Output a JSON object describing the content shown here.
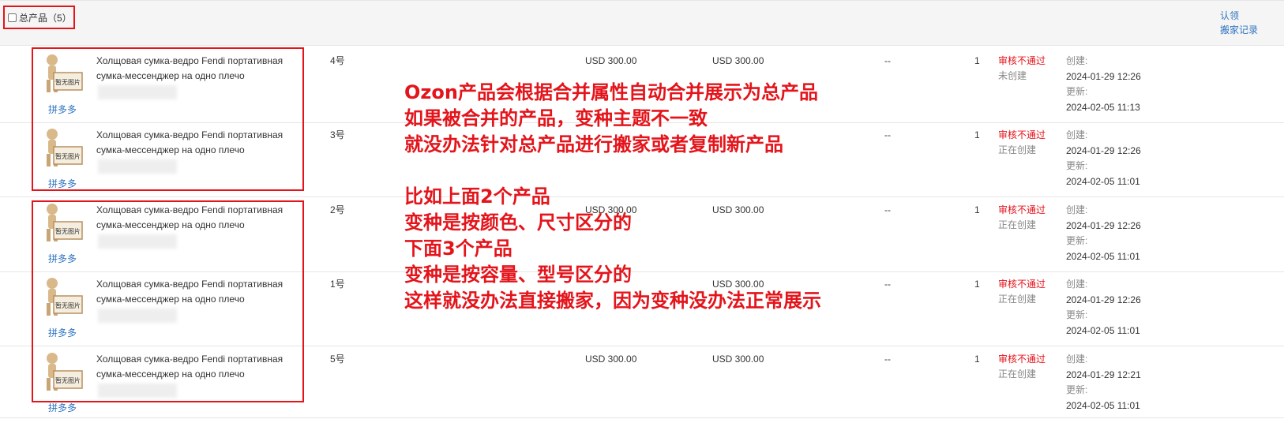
{
  "header": {
    "select_all_label": "总产品（5）",
    "links": [
      "认领",
      "搬家记录"
    ]
  },
  "placeholder_image_label": "暂无图片",
  "rows": [
    {
      "source": "拼多多",
      "title": "Холщовая сумка-ведро Fendi портативная сумка-мессенджер на одно плечо",
      "variant": "4号",
      "price1": "USD 300.00",
      "price2": "USD 300.00",
      "dash": "--",
      "qty": "1",
      "status1": "审核不通过",
      "status2": "未创建",
      "created_label": "创建:",
      "created": "2024-01-29 12:26",
      "updated_label": "更新:",
      "updated": "2024-02-05 11:13"
    },
    {
      "source": "拼多多",
      "title": "Холщовая сумка-ведро Fendi портативная сумка-мессенджер на одно плечо",
      "variant": "3号",
      "price1": "",
      "price2": "",
      "dash": "--",
      "qty": "1",
      "status1": "审核不通过",
      "status2": "正在创建",
      "created_label": "创建:",
      "created": "2024-01-29 12:26",
      "updated_label": "更新:",
      "updated": "2024-02-05 11:01"
    },
    {
      "source": "拼多多",
      "title": "Холщовая сумка-ведро Fendi портативная сумка-мессенджер на одно плечо",
      "variant": "2号",
      "price1": "USD 300.00",
      "price2": "USD 300.00",
      "dash": "--",
      "qty": "1",
      "status1": "审核不通过",
      "status2": "正在创建",
      "created_label": "创建:",
      "created": "2024-01-29 12:26",
      "updated_label": "更新:",
      "updated": "2024-02-05 11:01"
    },
    {
      "source": "拼多多",
      "title": "Холщовая сумка-ведро Fendi портативная сумка-мессенджер на одно плечо",
      "variant": "1号",
      "price1": "",
      "price2": "USD 300.00",
      "dash": "--",
      "qty": "1",
      "status1": "审核不通过",
      "status2": "正在创建",
      "created_label": "创建:",
      "created": "2024-01-29 12:26",
      "updated_label": "更新:",
      "updated": "2024-02-05 11:01"
    },
    {
      "source": "拼多多",
      "title": "Холщовая сумка-ведро Fendi портативная сумка-мессенджер на одно плечо",
      "variant": "5号",
      "price1": "USD 300.00",
      "price2": "USD 300.00",
      "dash": "--",
      "qty": "1",
      "status1": "审核不通过",
      "status2": "正在创建",
      "created_label": "创建:",
      "created": "2024-01-29 12:21",
      "updated_label": "更新:",
      "updated": "2024-02-05 11:01"
    }
  ],
  "annotation_lines": [
    "Ozon产品会根据合并属性自动合并展示为总产品",
    "如果被合并的产品，变种主题不一致",
    "就没办法针对总产品进行搬家或者复制新产品",
    "",
    "比如上面2个产品",
    "变种是按颜色、尺寸区分的",
    "下面3个产品",
    "变种是按容量、型号区分的",
    "这样就没办法直接搬家，因为变种没办法正常展示"
  ],
  "colors": {
    "accent_red": "#e4141b",
    "link_blue": "#2f74c0"
  }
}
